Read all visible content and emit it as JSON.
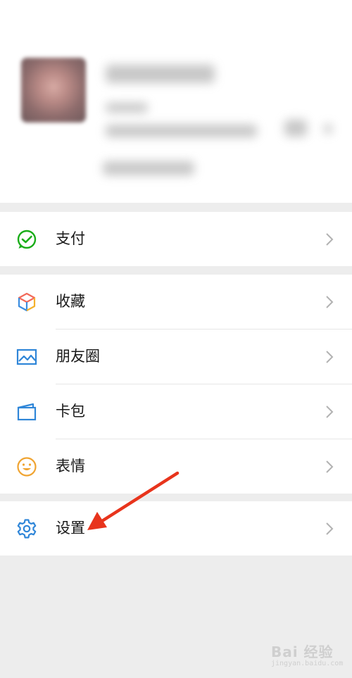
{
  "menu": {
    "pay": {
      "label": "支付",
      "icon": "wechat-pay-icon"
    },
    "favorites": {
      "label": "收藏",
      "icon": "favorites-cube-icon"
    },
    "moments": {
      "label": "朋友圈",
      "icon": "moments-image-icon"
    },
    "cards": {
      "label": "卡包",
      "icon": "card-wallet-icon"
    },
    "stickers": {
      "label": "表情",
      "icon": "sticker-face-icon"
    },
    "settings": {
      "label": "设置",
      "icon": "gear-icon"
    }
  },
  "annotation": {
    "arrow_color": "#e8341c"
  },
  "watermark": {
    "text": "Bai 经验",
    "sub": "jingyan.baidu.com"
  },
  "colors": {
    "background": "#ededed",
    "pay_green": "#1aad19",
    "icon_blue": "#2f86d8",
    "sticker_orange": "#f0a431"
  }
}
